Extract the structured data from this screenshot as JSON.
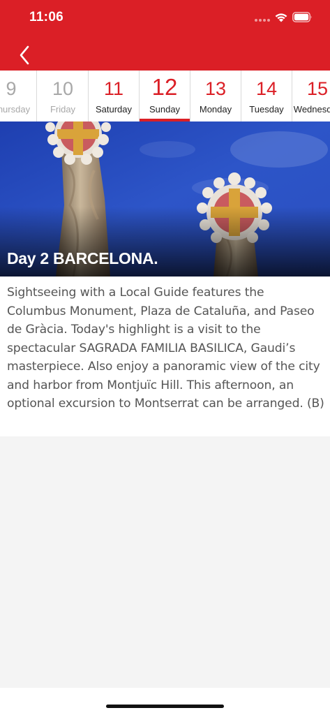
{
  "status_bar": {
    "time": "11:06"
  },
  "nav": {
    "back_icon": "chevron-left-icon"
  },
  "date_strip": {
    "dates": [
      {
        "num": "9",
        "day": "Thursday",
        "state": "past"
      },
      {
        "num": "10",
        "day": "Friday",
        "state": "past"
      },
      {
        "num": "11",
        "day": "Saturday",
        "state": "upcoming"
      },
      {
        "num": "12",
        "day": "Sunday",
        "state": "selected"
      },
      {
        "num": "13",
        "day": "Monday",
        "state": "upcoming"
      },
      {
        "num": "14",
        "day": "Tuesday",
        "state": "upcoming"
      },
      {
        "num": "15",
        "day": "Wednesday",
        "state": "upcoming"
      }
    ]
  },
  "hero": {
    "title": "Day 2 BARCELONA."
  },
  "content": {
    "description": "Sightseeing with a Local Guide features the Columbus Monument, Plaza de Cataluña, and Paseo de Gràcia. Today's highlight is a visit to the spectacular SAGRADA FAMILIA BASILICA, Gaudi’s masterpiece. Also enjoy a panoramic view of the city and harbor from Montjuïc Hill. This afternoon, an optional excursion to Montserrat can be arranged. (B)"
  },
  "colors": {
    "brand_red": "#db1f26",
    "past_date_gray": "#a8a8a8",
    "body_text": "#555555",
    "page_background": "#f4f4f4"
  }
}
